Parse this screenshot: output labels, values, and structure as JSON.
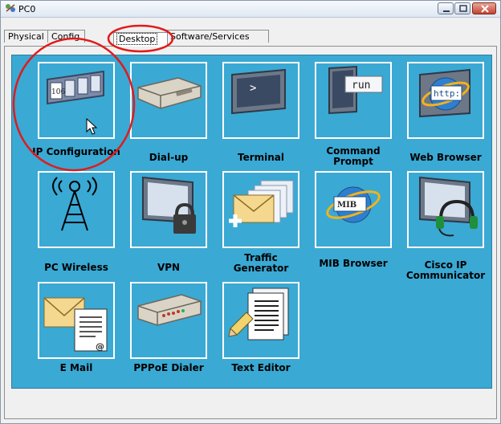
{
  "window": {
    "title": "PC0"
  },
  "tabs": [
    {
      "label": "Physical"
    },
    {
      "label": "Config"
    },
    {
      "label": "Desktop"
    },
    {
      "label": "Software/Services"
    }
  ],
  "desktop_apps": [
    {
      "label": "IP Configuration",
      "icon": "ip-configuration-icon",
      "screen_text": "106"
    },
    {
      "label": "Dial-up",
      "icon": "dial-up-modem-icon"
    },
    {
      "label": "Terminal",
      "icon": "terminal-icon",
      "screen_text": ">"
    },
    {
      "label": "Command Prompt",
      "icon": "command-prompt-icon",
      "screen_text": "run"
    },
    {
      "label": "Web Browser",
      "icon": "web-browser-icon",
      "screen_text": "http:"
    },
    {
      "label": "PC Wireless",
      "icon": "wireless-antenna-icon"
    },
    {
      "label": "VPN",
      "icon": "vpn-lock-icon"
    },
    {
      "label": "Traffic Generator",
      "icon": "traffic-generator-icon"
    },
    {
      "label": "MIB Browser",
      "icon": "mib-browser-icon",
      "screen_text": "MIB"
    },
    {
      "label": "Cisco IP Communicator",
      "icon": "ip-communicator-headset-icon"
    },
    {
      "label": "E Mail",
      "icon": "email-envelope-icon",
      "screen_text": "@"
    },
    {
      "label": "PPPoE Dialer",
      "icon": "pppoe-modem-icon"
    },
    {
      "label": "Text Editor",
      "icon": "text-editor-icon"
    }
  ],
  "colors": {
    "desktop_background": "#3aa9d4",
    "annotation_circle": "#e01b1b"
  }
}
